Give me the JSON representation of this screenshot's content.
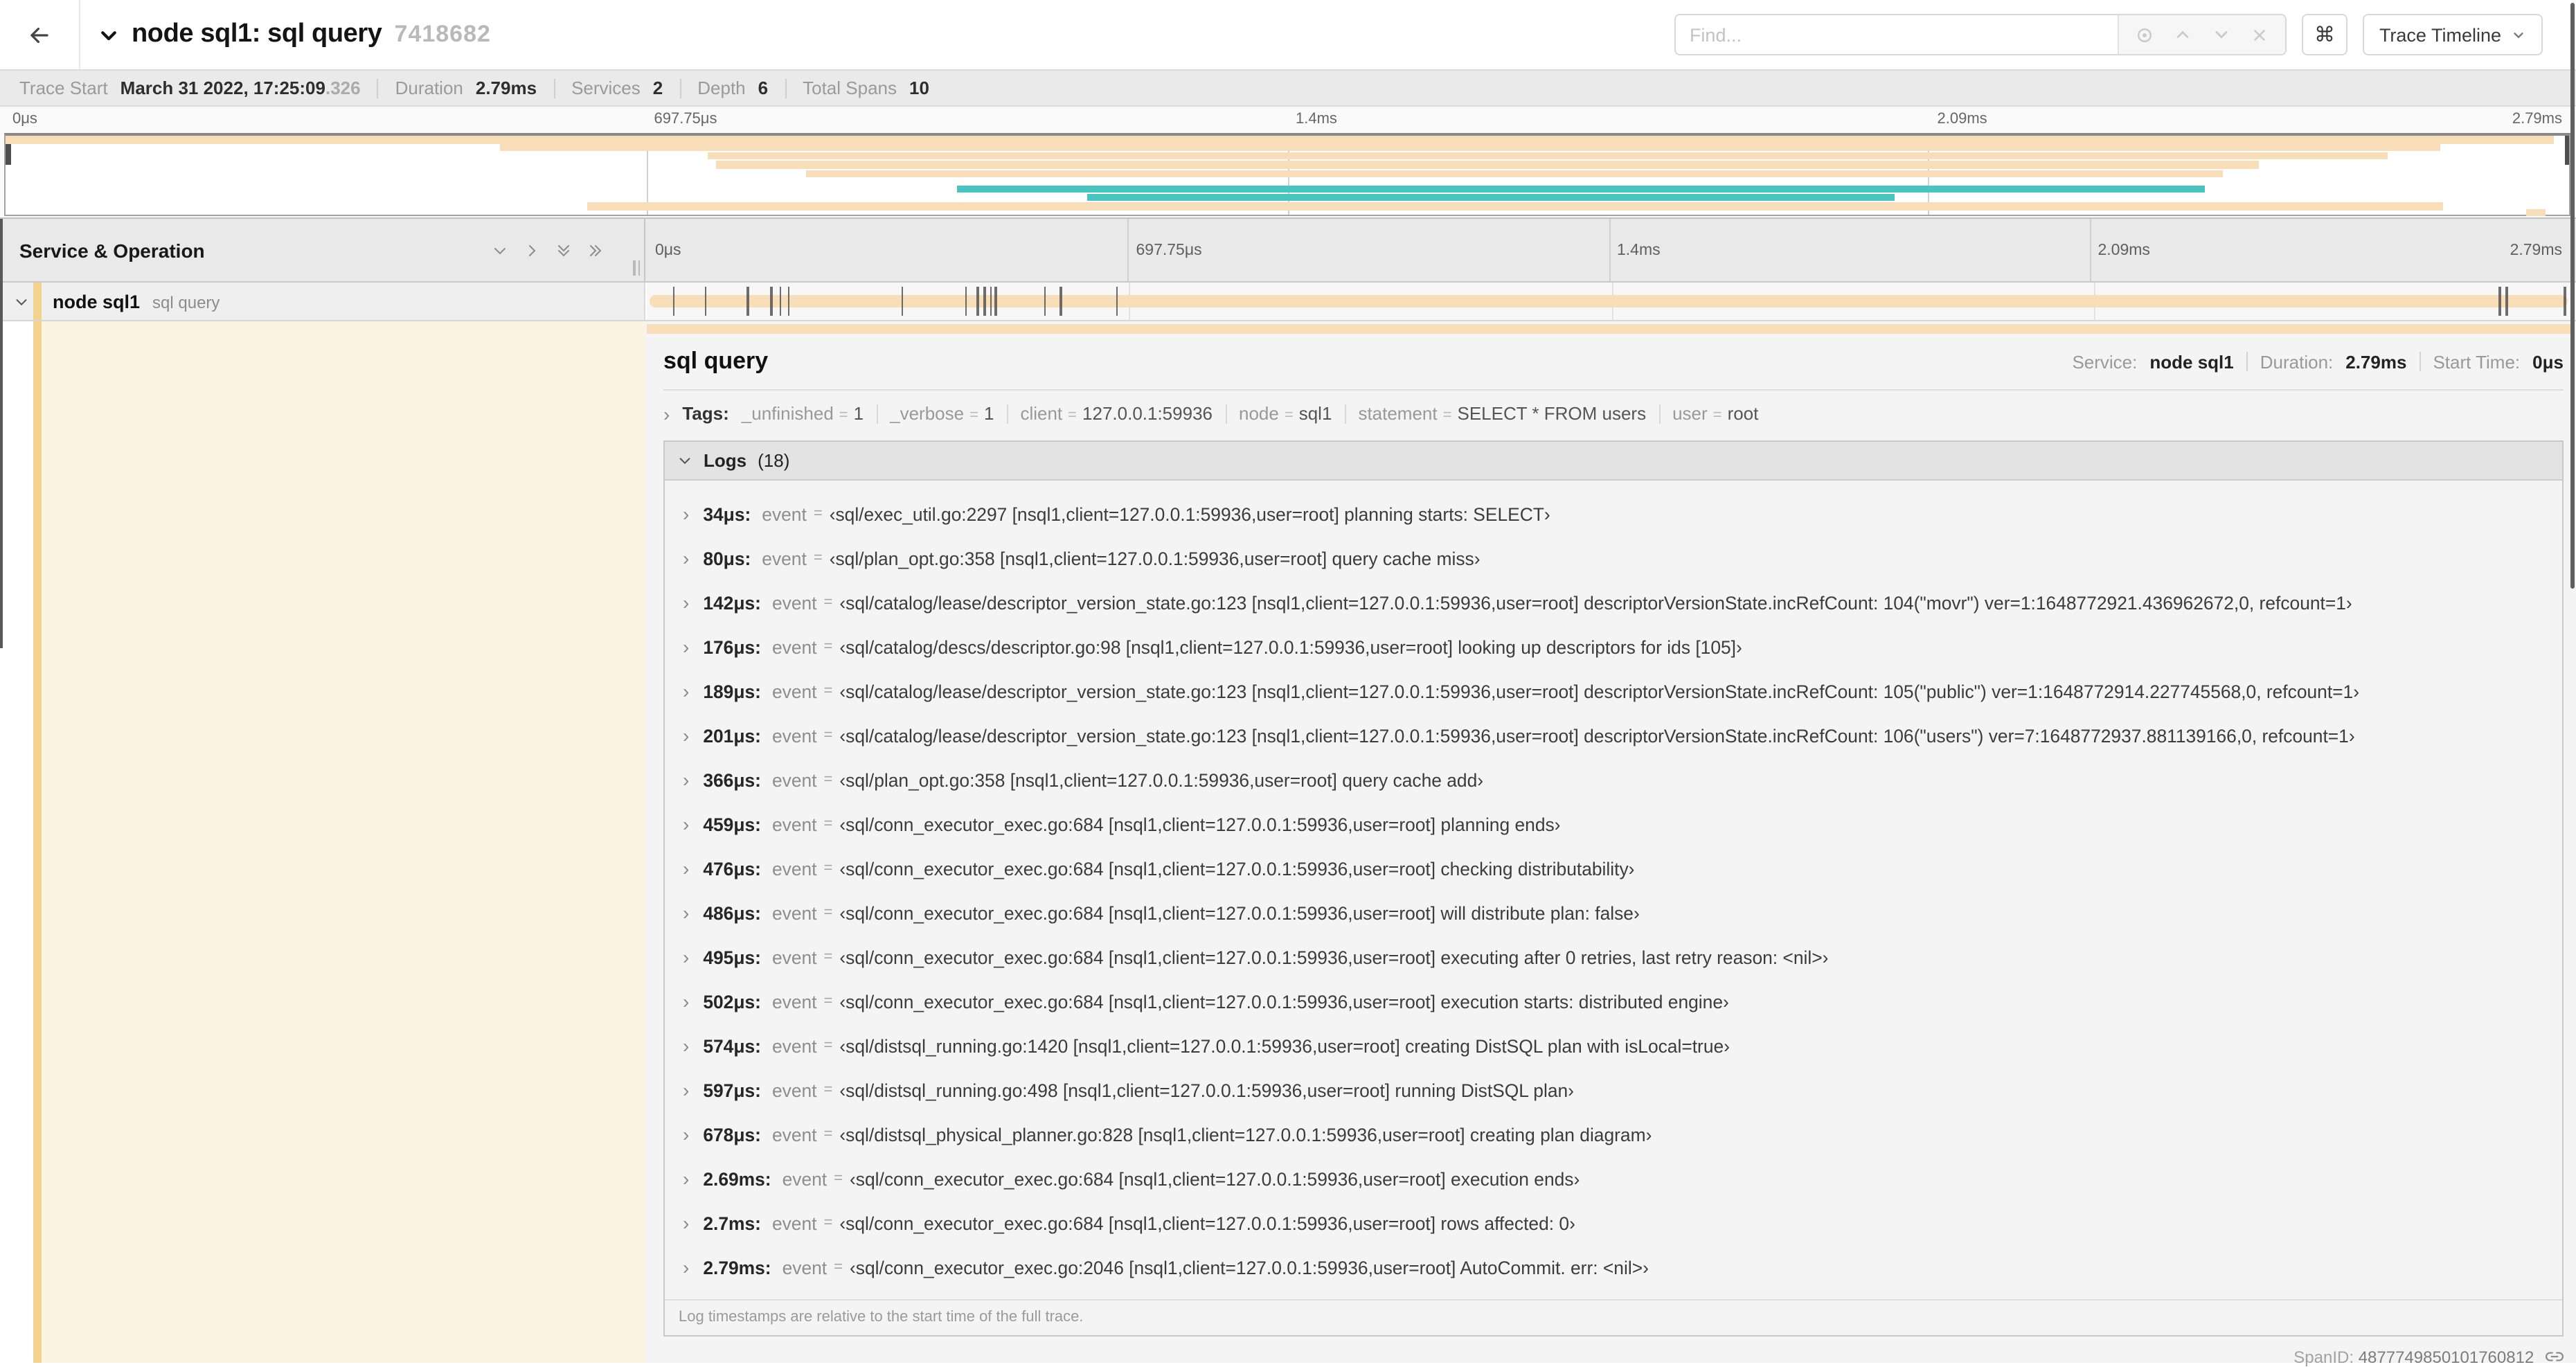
{
  "header": {
    "title": "node sql1: sql query",
    "trace_id": "7418682",
    "find_placeholder": "Find...",
    "shortcut_key": "⌘",
    "view_label": "Trace Timeline"
  },
  "trace_info": {
    "trace_start_label": "Trace Start",
    "trace_start_value": "March 31 2022, 17:25:09",
    "trace_start_fraction": ".326",
    "duration_label": "Duration",
    "duration": "2.79ms",
    "services_label": "Services",
    "services": "2",
    "depth_label": "Depth",
    "depth": "6",
    "total_spans_label": "Total Spans",
    "total_spans": "10"
  },
  "ruler_ticks": [
    "0μs",
    "697.75μs",
    "1.4ms",
    "2.09ms",
    "2.79ms"
  ],
  "timeline_header": {
    "title": "Service & Operation"
  },
  "span_row": {
    "service": "node sql1",
    "operation": "sql query"
  },
  "total_duration_us": 2790,
  "minimap": {
    "spans": [
      {
        "row": 0,
        "start": 0,
        "end": 99.4,
        "color": "beige"
      },
      {
        "row": 1,
        "start": 19.3,
        "end": 95.0,
        "color": "beige"
      },
      {
        "row": 2,
        "start": 27.4,
        "end": 92.9,
        "color": "beige"
      },
      {
        "row": 3,
        "start": 27.7,
        "end": 87.9,
        "color": "beige"
      },
      {
        "row": 4,
        "start": 31.2,
        "end": 86.5,
        "color": "beige"
      },
      {
        "row": 5,
        "start": 37.1,
        "end": 85.8,
        "color": "teal"
      },
      {
        "row": 6,
        "start": 42.2,
        "end": 73.7,
        "color": "teal"
      },
      {
        "row": 7,
        "start": 22.7,
        "end": 95.1,
        "color": "beige"
      },
      {
        "row": 8,
        "start": 98.3,
        "end": 99.1,
        "color": "beige"
      }
    ]
  },
  "detail": {
    "title": "sql query",
    "service_label": "Service:",
    "service": "node sql1",
    "duration_label": "Duration:",
    "duration": "2.79ms",
    "start_time_label": "Start Time:",
    "start_time": "0μs",
    "tags_label": "Tags:",
    "tags": [
      {
        "key": "_unfinished",
        "value": "1"
      },
      {
        "key": "_verbose",
        "value": "1"
      },
      {
        "key": "client",
        "value": "127.0.0.1:59936"
      },
      {
        "key": "node",
        "value": "sql1"
      },
      {
        "key": "statement",
        "value": "SELECT * FROM users"
      },
      {
        "key": "user",
        "value": "root"
      }
    ],
    "logs_label": "Logs",
    "logs_count": "(18)",
    "event_key": "event",
    "logs": [
      {
        "time": "34μs",
        "us": 34,
        "value": "‹sql/exec_util.go:2297 [nsql1,client=127.0.0.1:59936,user=root] planning starts: SELECT›"
      },
      {
        "time": "80μs",
        "us": 80,
        "value": "‹sql/plan_opt.go:358 [nsql1,client=127.0.0.1:59936,user=root] query cache miss›"
      },
      {
        "time": "142μs",
        "us": 142,
        "value": "‹sql/catalog/lease/descriptor_version_state.go:123 [nsql1,client=127.0.0.1:59936,user=root] descriptorVersionState.incRefCount: 104(\"movr\") ver=1:1648772921.436962672,0, refcount=1›"
      },
      {
        "time": "176μs",
        "us": 176,
        "value": "‹sql/catalog/descs/descriptor.go:98 [nsql1,client=127.0.0.1:59936,user=root] looking up descriptors for ids [105]›"
      },
      {
        "time": "189μs",
        "us": 189,
        "value": "‹sql/catalog/lease/descriptor_version_state.go:123 [nsql1,client=127.0.0.1:59936,user=root] descriptorVersionState.incRefCount: 105(\"public\") ver=1:1648772914.227745568,0, refcount=1›"
      },
      {
        "time": "201μs",
        "us": 201,
        "value": "‹sql/catalog/lease/descriptor_version_state.go:123 [nsql1,client=127.0.0.1:59936,user=root] descriptorVersionState.incRefCount: 106(\"users\") ver=7:1648772937.881139166,0, refcount=1›"
      },
      {
        "time": "366μs",
        "us": 366,
        "value": "‹sql/plan_opt.go:358 [nsql1,client=127.0.0.1:59936,user=root] query cache add›"
      },
      {
        "time": "459μs",
        "us": 459,
        "value": "‹sql/conn_executor_exec.go:684 [nsql1,client=127.0.0.1:59936,user=root] planning ends›"
      },
      {
        "time": "476μs",
        "us": 476,
        "value": "‹sql/conn_executor_exec.go:684 [nsql1,client=127.0.0.1:59936,user=root] checking distributability›"
      },
      {
        "time": "486μs",
        "us": 486,
        "value": "‹sql/conn_executor_exec.go:684 [nsql1,client=127.0.0.1:59936,user=root] will distribute plan: false›"
      },
      {
        "time": "495μs",
        "us": 495,
        "value": "‹sql/conn_executor_exec.go:684 [nsql1,client=127.0.0.1:59936,user=root] executing after 0 retries, last retry reason: <nil>›"
      },
      {
        "time": "502μs",
        "us": 502,
        "value": "‹sql/conn_executor_exec.go:684 [nsql1,client=127.0.0.1:59936,user=root] execution starts: distributed engine›"
      },
      {
        "time": "574μs",
        "us": 574,
        "value": "‹sql/distsql_running.go:1420 [nsql1,client=127.0.0.1:59936,user=root] creating DistSQL plan with isLocal=true›"
      },
      {
        "time": "597μs",
        "us": 597,
        "value": "‹sql/distsql_running.go:498 [nsql1,client=127.0.0.1:59936,user=root] running DistSQL plan›"
      },
      {
        "time": "678μs",
        "us": 678,
        "value": "‹sql/distsql_physical_planner.go:828 [nsql1,client=127.0.0.1:59936,user=root] creating plan diagram›"
      },
      {
        "time": "2.69ms",
        "us": 2690,
        "value": "‹sql/conn_executor_exec.go:684 [nsql1,client=127.0.0.1:59936,user=root] execution ends›"
      },
      {
        "time": "2.7ms",
        "us": 2700,
        "value": "‹sql/conn_executor_exec.go:684 [nsql1,client=127.0.0.1:59936,user=root] rows affected: 0›"
      },
      {
        "time": "2.79ms",
        "us": 2790,
        "value": "‹sql/conn_executor_exec.go:2046 [nsql1,client=127.0.0.1:59936,user=root] AutoCommit. err: <nil>›"
      }
    ],
    "logs_note": "Log timestamps are relative to the start time of the full trace.",
    "span_id_label": "SpanID:",
    "span_id": "4877749850101760812"
  },
  "colors": {
    "span_beige": "#f8deb8",
    "span_teal": "#49c5c1",
    "stripe_beige": "#f2d28d",
    "cream_bg": "#fcf4e3"
  }
}
